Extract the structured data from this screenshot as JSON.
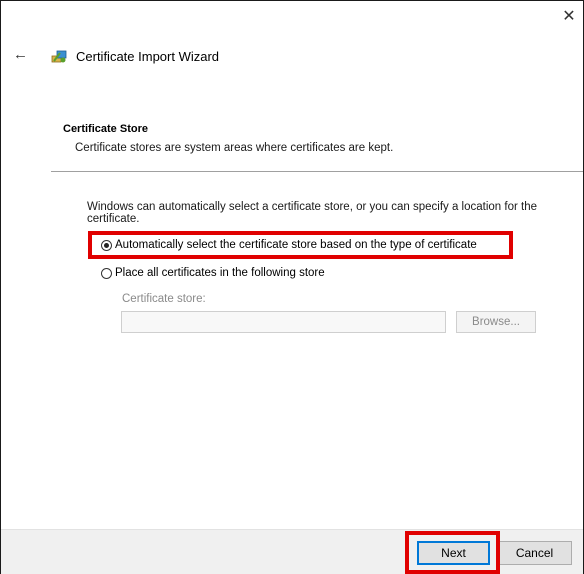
{
  "window": {
    "title": "Certificate Import Wizard",
    "close_glyph": "✕",
    "back_glyph": "←"
  },
  "section": {
    "title": "Certificate Store",
    "description": "Certificate stores are system areas where certificates are kept."
  },
  "intro_text": "Windows can automatically select a certificate store, or you can specify a location for the certificate.",
  "options": [
    {
      "label": "Automatically select the certificate store based on the type of certificate",
      "selected": true
    },
    {
      "label": "Place all certificates in the following store",
      "selected": false
    }
  ],
  "store": {
    "label": "Certificate store:",
    "value": "",
    "browse_label": "Browse..."
  },
  "buttons": {
    "next": "Next",
    "cancel": "Cancel"
  },
  "colors": {
    "highlight": "#e00000",
    "focus_border": "#0078d7"
  }
}
